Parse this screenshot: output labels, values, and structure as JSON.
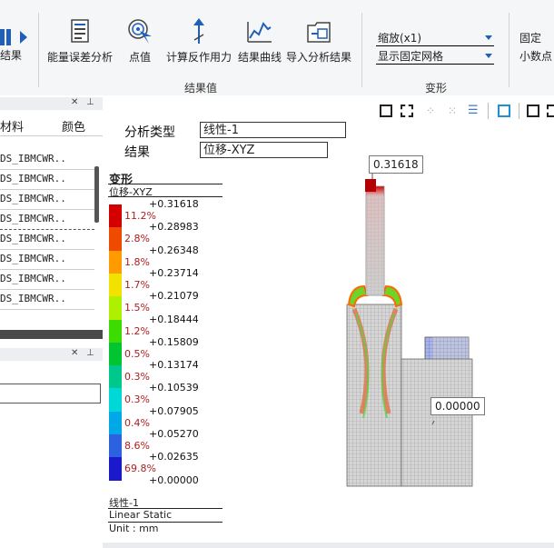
{
  "ribbon": {
    "left_fragment": "结果",
    "buttons": [
      {
        "label": "能量误差分析",
        "icon": "document-chart-icon"
      },
      {
        "label": "点值",
        "icon": "target-cursor-icon"
      },
      {
        "label": "计算反作用力",
        "icon": "reaction-force-icon"
      },
      {
        "label": "结果曲线",
        "icon": "result-curve-icon"
      },
      {
        "label": "导入分析结果",
        "icon": "import-folder-icon"
      }
    ],
    "group_result": "结果值",
    "group_deform": "变形",
    "scale_combo": "缩放(x1)",
    "mesh_combo": "显示固定网格",
    "fixed_label": "固定",
    "decimal_label": "小数点"
  },
  "left_panel": {
    "col_material": "材料",
    "col_color": "颜色",
    "rows": [
      "DS_IBMCWR..",
      "DS_IBMCWR..",
      "DS_IBMCWR..",
      "DS_IBMCWR..",
      "DS_IBMCWR..",
      "DS_IBMCWR..",
      "DS_IBMCWR..",
      "DS_IBMCWR.."
    ]
  },
  "viewport": {
    "analysis_type_label": "分析类型",
    "analysis_type_value": "线性-1",
    "result_label": "结果",
    "result_value": "位移-XYZ",
    "legend_title": "变形",
    "legend_subtitle": "位移-XYZ",
    "legend_values": [
      "+0.31618",
      "+0.28983",
      "+0.26348",
      "+0.23714",
      "+0.21079",
      "+0.18444",
      "+0.15809",
      "+0.13174",
      "+0.10539",
      "+0.07905",
      "+0.05270",
      "+0.02635",
      "+0.00000"
    ],
    "legend_percents": [
      "11.2%",
      "2.8%",
      "1.8%",
      "1.7%",
      "1.5%",
      "1.2%",
      "0.5%",
      "0.3%",
      "0.3%",
      "0.4%",
      "8.6%",
      "69.8%"
    ],
    "legend_colors": [
      "#d40000",
      "#f04a00",
      "#ff9a00",
      "#f2e200",
      "#aef000",
      "#3ddc00",
      "#00c430",
      "#00c88c",
      "#00d8d8",
      "#00a8e8",
      "#2c62e0",
      "#1a1acc"
    ],
    "footer_case": "线性-1",
    "footer_type": "Linear Static",
    "footer_unit": "Unit : mm",
    "max_callout": "0.31618",
    "min_callout": "0.00000"
  }
}
